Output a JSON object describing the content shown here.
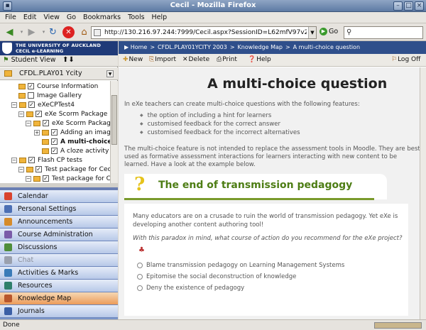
{
  "window": {
    "title": "Cecil - Mozilla Firefox"
  },
  "menubar": [
    "File",
    "Edit",
    "View",
    "Go",
    "Bookmarks",
    "Tools",
    "Help"
  ],
  "nav": {
    "url": "http://130.216.97.244:7999/Cecil.aspx?SessionID=L62mfV97v2a",
    "go_label": "Go"
  },
  "sidebar": {
    "logo_line1": "THE UNIVERSITY OF AUCKLAND",
    "logo_line2": "CECIL e-LEARNING",
    "student_view": "Student View",
    "course": "CFDL.PLAY01 Ycity",
    "tree": [
      "Course Information",
      "Image Gallery",
      "eXeCPTest4",
      "eXe Scorm Package",
      "eXe Scorm Package",
      "Adding an image",
      "A multi-choice q",
      "A cloze activity",
      "Flash CP tests",
      "Test package for Cecil",
      "Test package for Ceci"
    ],
    "menu": [
      "Calendar",
      "Personal Settings",
      "Announcements",
      "Course Administration",
      "Discussions",
      "Chat",
      "Activities & Marks",
      "Resources",
      "Knowledge Map",
      "Journals"
    ],
    "menu_colors": [
      "#d9432e",
      "#4c6fb4",
      "#d68b2a",
      "#7a5ba8",
      "#4f8d3a",
      "#9aa0ad",
      "#3a7bb8",
      "#2f7f6a",
      "#b8562c",
      "#3b5fa6"
    ]
  },
  "breadcrumb": [
    "Home",
    "CFDL.PLAY01YCITY 2003",
    "Knowledge Map",
    "A multi-choice question"
  ],
  "toolbar": {
    "new": "New",
    "import": "Import",
    "delete": "Delete",
    "print": "Print",
    "help": "Help",
    "logoff": "Log Off"
  },
  "page": {
    "title": "A multi-choice question",
    "intro": "In eXe teachers can create multi-choice questions with the following features:",
    "bullets": [
      "the option of including a hint for learners",
      "customised feedback for the correct answer",
      "customised feedback for the incorrect alternatives"
    ],
    "para2": "The multi-choice feature is not intended to replace the assessment tools in Moodle. They are best used as formative assessment interactions for learners interacting with new content to be learned. Have a look at the example below.",
    "card_title": "The end of transmission pedagogy",
    "card_p1": "Many educators are on a crusade to ruin the world of transmission pedagogy. Yet eXe is developing another content authoring tool!",
    "card_p2": "With this paradox in mind, what course of action do you recommend for the eXe project?",
    "options": [
      "Blame transmission pedagogy on Learning Management Systems",
      "Epitomise the social deconstruction of knowledge",
      "Deny the existence of pedagogy"
    ]
  },
  "status": "Done"
}
